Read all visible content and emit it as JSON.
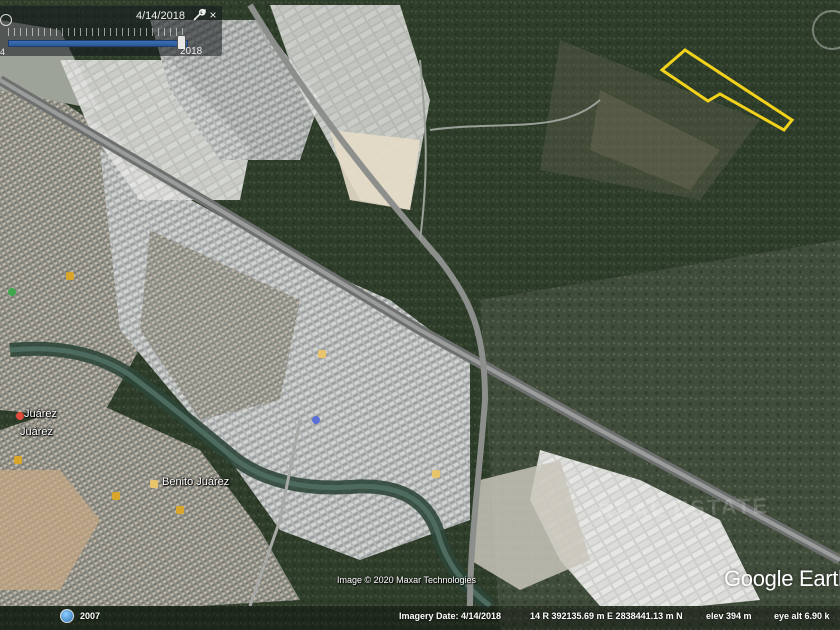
{
  "viewer": {
    "historical_slider": {
      "current_date": "4/14/2018",
      "range_start_label": "4",
      "range_end_label": "2018",
      "position_fraction": 0.97,
      "icons": [
        "clock-icon",
        "wrench-icon",
        "close-icon"
      ],
      "close_label": "×"
    },
    "places": [
      {
        "id": "juarez-1",
        "label": "Juárez"
      },
      {
        "id": "juarez-2",
        "label": "Juárez"
      },
      {
        "id": "benito-juarez",
        "label": "Benito Juárez"
      }
    ],
    "attribution": "Image © 2020 Maxar Technologies",
    "brand": "Google Earth",
    "status": {
      "tour_year": "2007",
      "imagery_date": "Imagery Date: 4/14/2018",
      "coordinates": "14 R 392135.69 m E 2838441.13 m N",
      "elevation": "elev   394 m",
      "eye_alt": "eye alt   6.90 k"
    },
    "highlight_polygon": {
      "color": "#f2d21b",
      "icon": "parcel-outline"
    },
    "colors": {
      "urban": "#b9bcbc",
      "vegetation": "#2f3f2c",
      "river": "#3f5a4e",
      "highway": "#8a8d8e"
    }
  }
}
